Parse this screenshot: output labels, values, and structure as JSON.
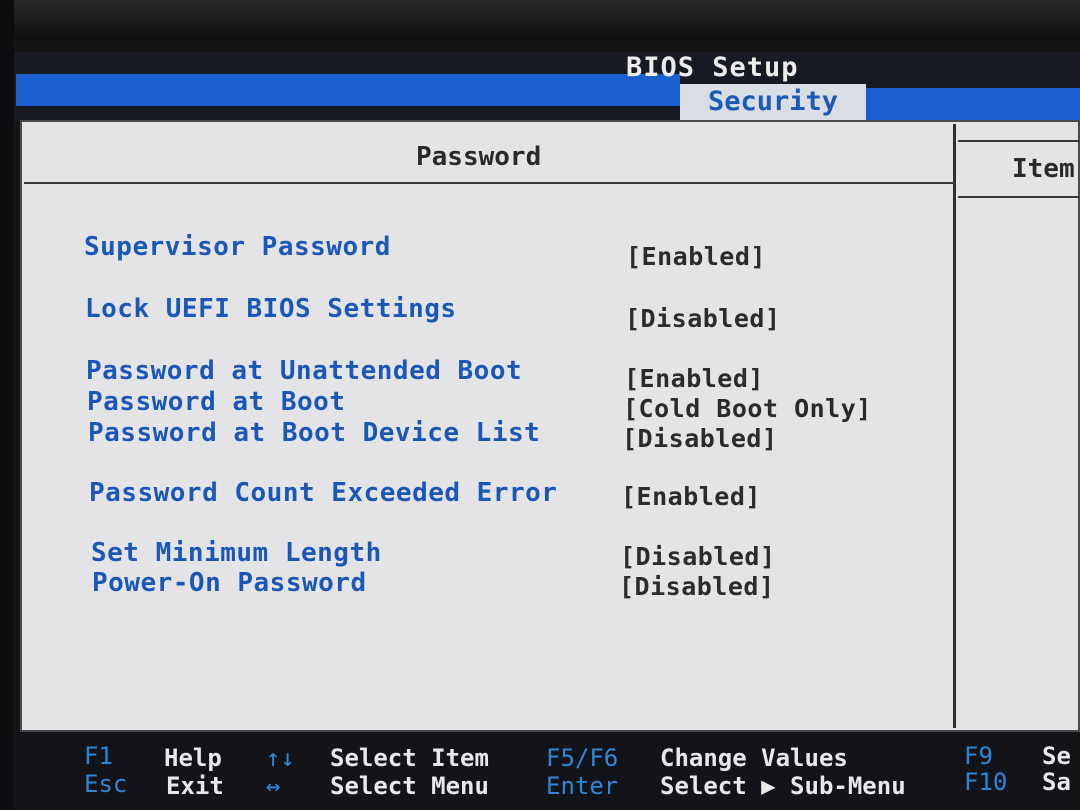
{
  "header": {
    "title": "BIOS Setup",
    "active_tab": "Security"
  },
  "panel": {
    "title": "Password",
    "help_title": "Item"
  },
  "options": [
    {
      "label": "Supervisor Password",
      "value": "[Enabled]"
    },
    {
      "label": "Lock UEFI BIOS Settings",
      "value": "[Disabled]"
    },
    {
      "label": "Password at Unattended Boot",
      "value": "[Enabled]"
    },
    {
      "label": "Password at Boot",
      "value": "[Cold Boot Only]"
    },
    {
      "label": "Password at Boot Device List",
      "value": "[Disabled]"
    },
    {
      "label": "Password Count Exceeded Error",
      "value": "[Enabled]"
    },
    {
      "label": "Set Minimum Length",
      "value": "[Disabled]"
    },
    {
      "label": "Power-On Password",
      "value": "[Disabled]"
    }
  ],
  "footer": {
    "f1_key": "F1",
    "f1_desc": "Help",
    "esc_key": "Esc",
    "esc_desc": "Exit",
    "updown_key": "↑↓",
    "updown_desc": "Select Item",
    "leftright_key": "↔",
    "leftright_desc": "Select Menu",
    "f5f6_key": "F5/F6",
    "f5f6_desc": "Change Values",
    "enter_key": "Enter",
    "enter_desc": "Select ▶ Sub-Menu",
    "f9_key": "F9",
    "f9_desc": "Se",
    "f10_key": "F10",
    "f10_desc": "Sa"
  },
  "colors": {
    "accent_blue": "#1a5ed0",
    "label_blue": "#1b57b6",
    "panel_bg": "#e4e4e6",
    "footer_key": "#2f86d6"
  }
}
